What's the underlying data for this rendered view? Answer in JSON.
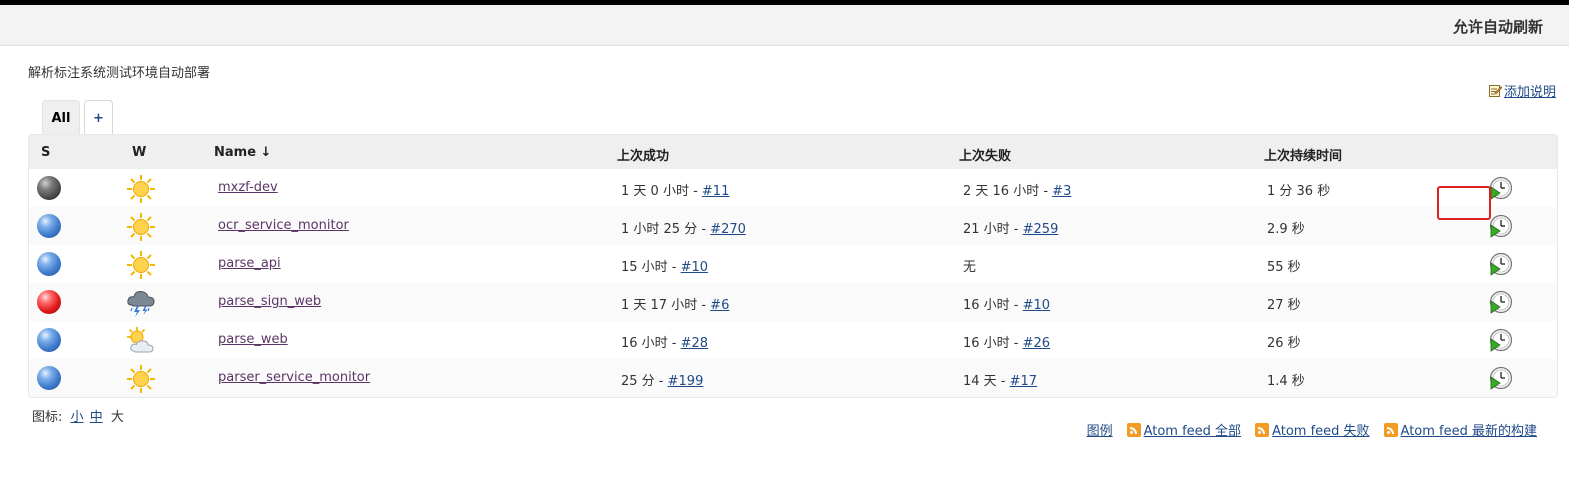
{
  "header": {
    "auto_refresh": "允许自动刷新"
  },
  "description": "解析标注系统测试环境自动部署",
  "add_description": "添加说明",
  "tabs": {
    "all": "All",
    "add": "+"
  },
  "columns": {
    "s": "S",
    "w": "W",
    "name": "Name ↓",
    "last_success": "上次成功",
    "last_failure": "上次失败",
    "last_duration": "上次持续时间"
  },
  "jobs": [
    {
      "status": "grey",
      "weather": "sunny",
      "name": "mxzf-dev",
      "success_time": "1 天 0 小时 - ",
      "success_build": "#11",
      "failure_time": "2 天 16 小时 - ",
      "failure_build": "#3",
      "duration": "1 分 36 秒"
    },
    {
      "status": "blue",
      "weather": "sunny",
      "name": "ocr_service_monitor",
      "success_time": "1 小时 25 分 - ",
      "success_build": "#270",
      "failure_time": "21 小时 - ",
      "failure_build": "#259",
      "duration": "2.9 秒"
    },
    {
      "status": "blue",
      "weather": "sunny",
      "name": "parse_api",
      "success_time": "15 小时 - ",
      "success_build": "#10",
      "failure_time": "无",
      "failure_build": "",
      "duration": "55 秒"
    },
    {
      "status": "red",
      "weather": "stormy",
      "name": "parse_sign_web",
      "success_time": "1 天 17 小时 - ",
      "success_build": "#6",
      "failure_time": "16 小时 - ",
      "failure_build": "#10",
      "duration": "27 秒"
    },
    {
      "status": "blue",
      "weather": "partly-cloudy",
      "name": "parse_web",
      "success_time": "16 小时 - ",
      "success_build": "#28",
      "failure_time": "16 小时 - ",
      "failure_build": "#26",
      "duration": "26 秒"
    },
    {
      "status": "blue",
      "weather": "sunny",
      "name": "parser_service_monitor",
      "success_time": "25 分 - ",
      "success_build": "#199",
      "failure_time": "14 天 - ",
      "failure_build": "#17",
      "duration": "1.4 秒"
    }
  ],
  "icon_size": {
    "label": "图标:",
    "small": "小",
    "medium": "中",
    "large": "大"
  },
  "footer": {
    "legend": "图例",
    "feed_all": "Atom feed 全部",
    "feed_failed": "Atom feed 失败",
    "feed_latest": "Atom feed 最新的构建"
  },
  "colors": {
    "link": "#204a87",
    "header_bg": "#f3f3f3",
    "highlight": "#e02020"
  }
}
